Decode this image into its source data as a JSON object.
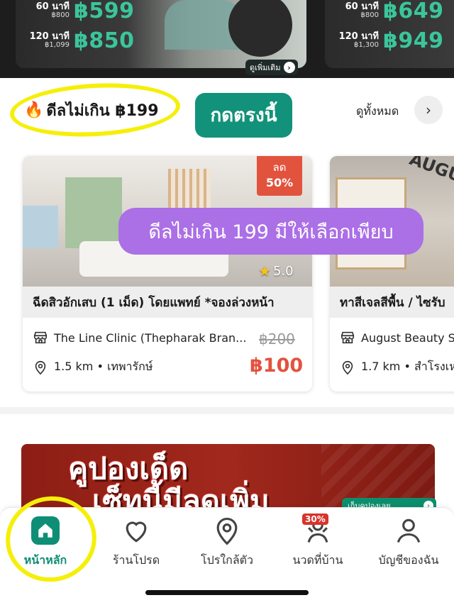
{
  "top_promos": {
    "left": {
      "rows": [
        {
          "duration": "60 นาที",
          "old": "฿800",
          "price": "฿599"
        },
        {
          "duration": "120 นาที",
          "old": "฿1,099",
          "price": "฿850"
        }
      ],
      "see_more": "ดูเพิ่มเติม"
    },
    "right": {
      "rows": [
        {
          "duration": "60 นาที",
          "old": "฿800",
          "price": "฿649"
        },
        {
          "duration": "120 นาที",
          "old": "฿1,300",
          "price": "฿949"
        }
      ]
    }
  },
  "deal_section": {
    "title": "ดีลไม่เกิน ฿199",
    "press_button": "กดตรงนี้",
    "view_all": "ดูทั้งหมด"
  },
  "cards": [
    {
      "discount_line1": "ลด",
      "discount_line2": "50%",
      "rating": "5.0",
      "title": "ฉีดสิวอักเสบ (1 เม็ด) โดยแพทย์ *จองล่วงหน้า",
      "shop": "The Line Clinic (Thepharak Bran...",
      "location": "1.5 km • เทพารักษ์",
      "old_price": "฿200",
      "new_price": "฿100"
    },
    {
      "title": "ทาสีเจลสีพื้น / ไซรับ",
      "shop": "August Beauty S",
      "location": "1.7 km • สำโรงเหนื",
      "photo_text": "AUGUST"
    }
  ],
  "overlay_text": "ดีลไม่เกิน 199 มีให้เลือกเพียบ",
  "coupon": {
    "line1": "คูปองเด็ด",
    "line2": "เซ็ทนี้มีลดเพิ่ม",
    "chip": "เก็บคูปองเลย"
  },
  "nav": {
    "home": "หน้าหลัก",
    "favorites": "ร้านโปรด",
    "nearby": "โปรใกล้ตัว",
    "massage": "นวดที่บ้าน",
    "massage_badge": "30%",
    "account": "บัญชีของฉัน"
  },
  "colors": {
    "brand_green": "#0e8f75",
    "price_red": "#e2533e",
    "overlay_purple": "#ab6fe6",
    "highlight_yellow": "#f5ef0a"
  }
}
